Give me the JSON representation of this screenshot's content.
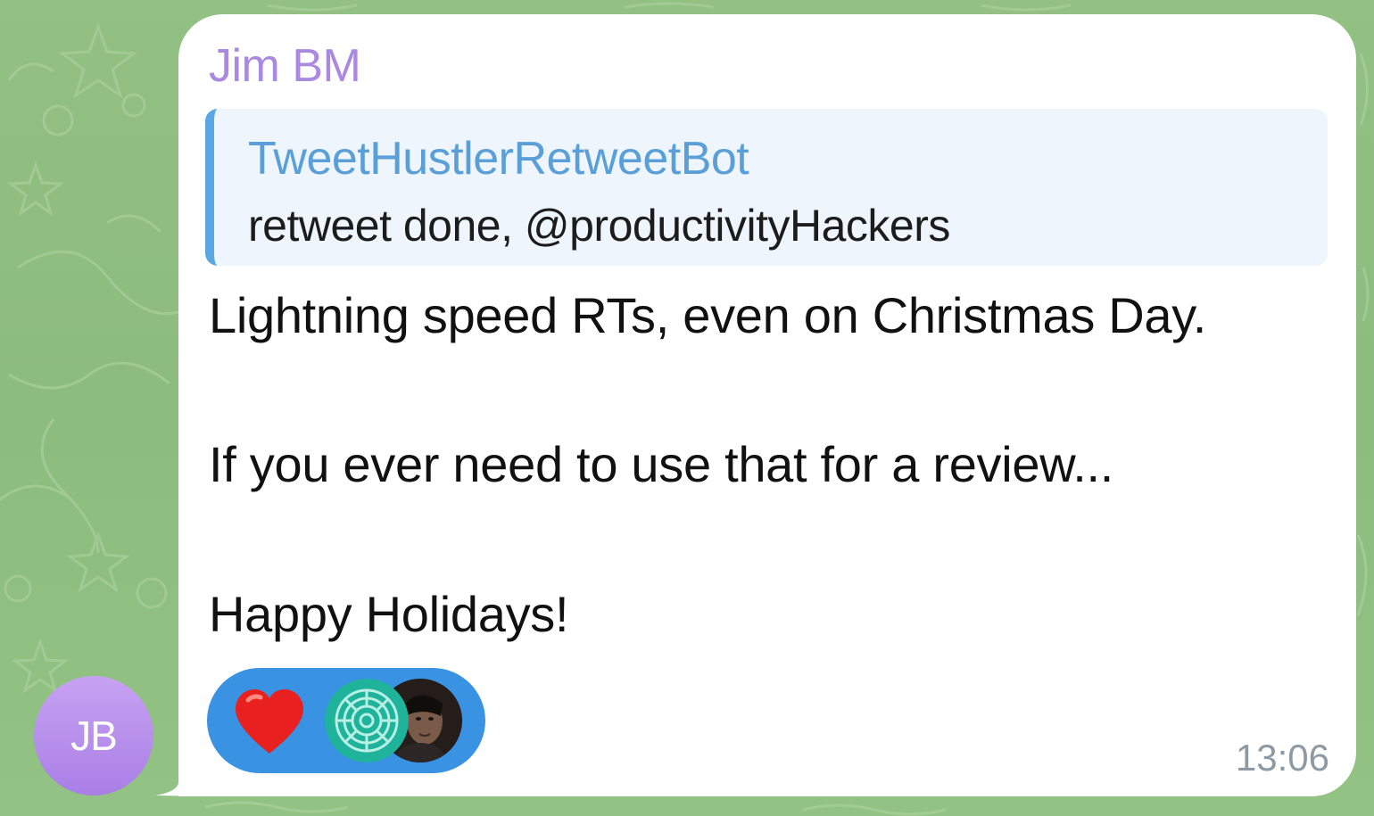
{
  "sender": {
    "name": "Jim BM",
    "avatar_initials": "JB",
    "name_color": "#a98ae0"
  },
  "reply": {
    "author": "TweetHustlerRetweetBot",
    "text": "retweet done, @productivityHackers",
    "accent_color": "#5ba7e3"
  },
  "message": {
    "lines": [
      "Lightning speed RTs, even on Christmas Day.",
      "If you ever need to use that for a review...",
      "Happy Holidays!"
    ],
    "time": "13:06"
  },
  "reactions": {
    "emoji": "heart-icon",
    "reactors": [
      "teal-spiral-avatar",
      "person-photo-avatar"
    ],
    "pill_color": "#3a92e3"
  },
  "colors": {
    "chat_background": "#8fbf7f",
    "bubble": "#ffffff"
  }
}
